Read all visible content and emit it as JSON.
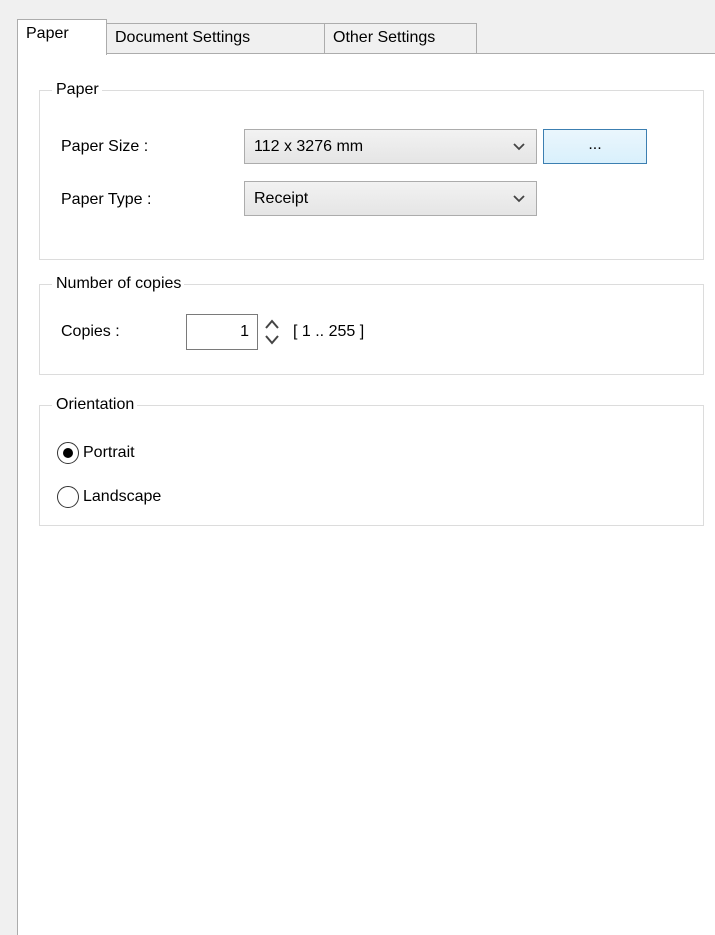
{
  "tabs": [
    {
      "label": "Paper",
      "active": true
    },
    {
      "label": "Document Settings",
      "active": false
    },
    {
      "label": "Other Settings",
      "active": false
    }
  ],
  "paper_group": {
    "legend": "Paper",
    "paper_size": {
      "label": "Paper Size :",
      "value": "112 x 3276 mm",
      "browse_label": "..."
    },
    "paper_type": {
      "label": "Paper Type :",
      "value": "Receipt"
    }
  },
  "copies_group": {
    "legend": "Number of copies",
    "label": "Copies :",
    "value": "1",
    "range": "[ 1 .. 255 ]"
  },
  "orientation_group": {
    "legend": "Orientation",
    "options": [
      {
        "label": "Portrait",
        "selected": true
      },
      {
        "label": "Landscape",
        "selected": false
      }
    ]
  },
  "colors": {
    "accent_border": "#3c7fb1",
    "accent_fill": "#d9f0fc"
  },
  "icons": {
    "combo_arrow": "chevron-down-icon",
    "spin_arrows": "spin-up-down-icon"
  }
}
